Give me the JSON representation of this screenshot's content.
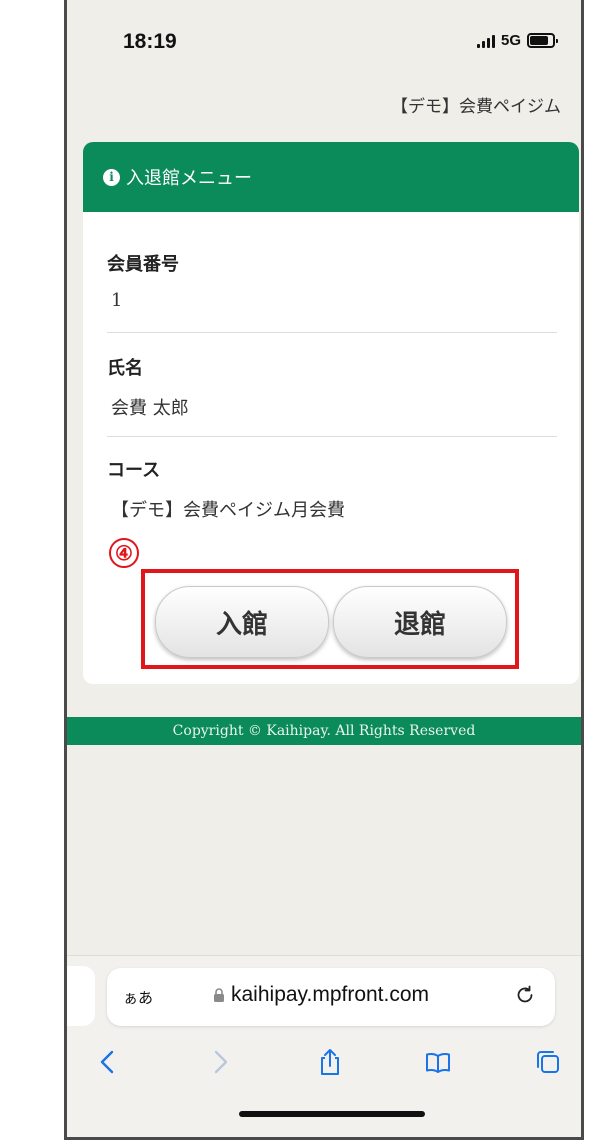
{
  "status_bar": {
    "time": "18:19",
    "network": "5G"
  },
  "site_name": "【デモ】会費ペイジム",
  "card": {
    "title": "入退館メニュー",
    "fields": [
      {
        "label": "会員番号",
        "value": "1"
      },
      {
        "label": "氏名",
        "value": "会費 太郎"
      },
      {
        "label": "コース",
        "value": "【デモ】会費ペイジム月会費"
      }
    ]
  },
  "annotation": {
    "marker": "④",
    "color": "#e0161b"
  },
  "buttons": {
    "check_in": "入館",
    "check_out": "退館"
  },
  "footer": {
    "copyright": "Copyright © Kaihipay. All Rights Reserved"
  },
  "browser": {
    "text_size_label": "ぁあ",
    "url": "kaihipay.mpfront.com"
  },
  "colors": {
    "brand_green": "#0b8a5a",
    "background": "#efeee9",
    "accent_blue": "#1a73e8"
  }
}
